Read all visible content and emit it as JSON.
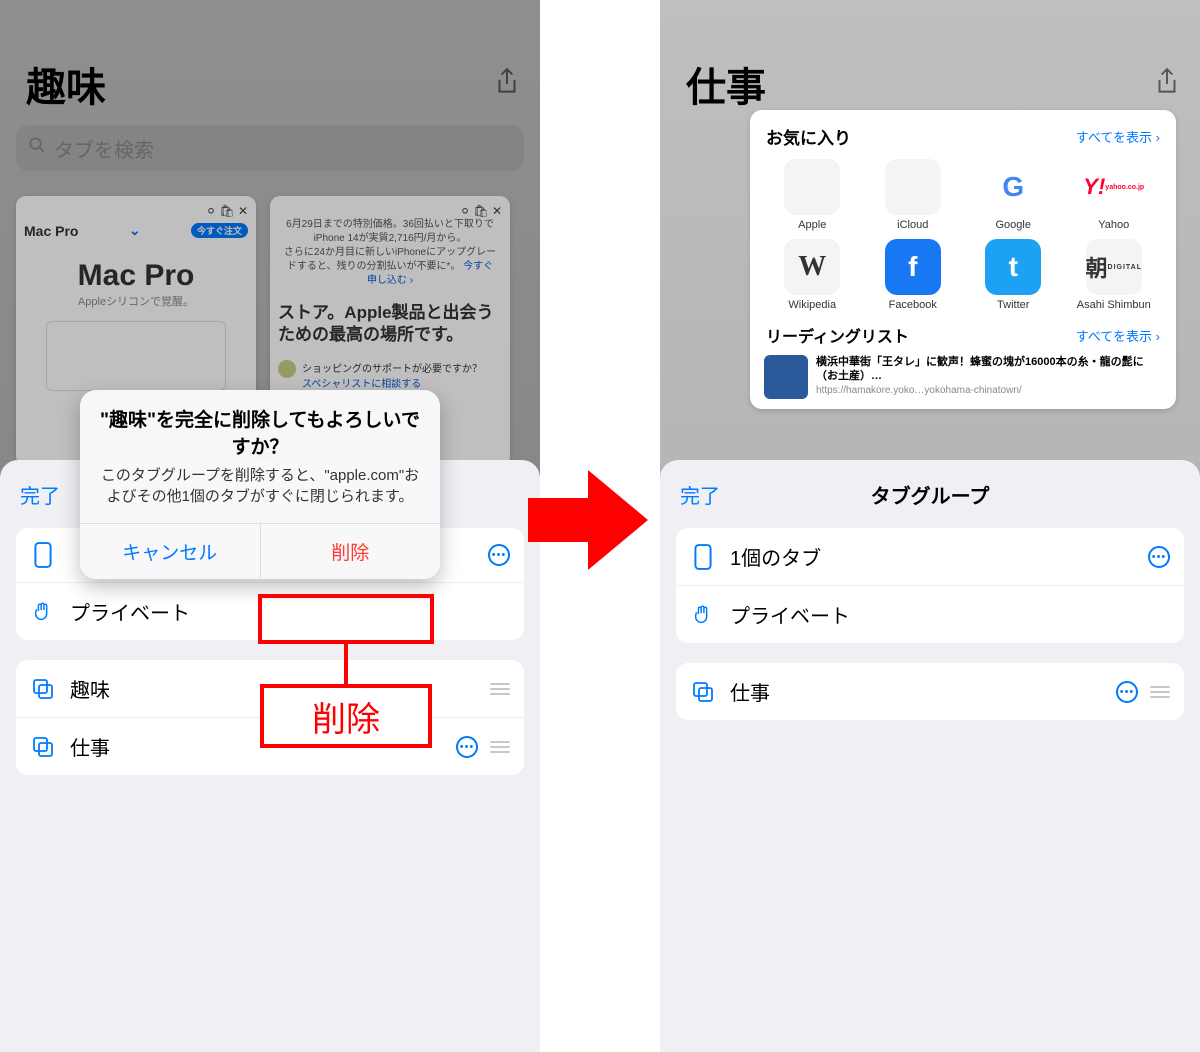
{
  "left": {
    "title": "趣味",
    "search_placeholder": "タブを検索",
    "tab1": {
      "name": "Mac Pro",
      "big": "Mac Pro",
      "sub": "Appleシリコンで覚醒。"
    },
    "tab2": {
      "note1": "6月29日までの特別価格。36回払いと下取りでiPhone 14が実質2,716円/月から。",
      "note2": "さらに24か月目に新しいiPhoneにアップグレードすると、残りの分割払いが不要に*。",
      "applynow": "今すぐ申し込む ›",
      "head": "ストア。Apple製品と出会うための最高の場所です。",
      "support1": "ショッピングのサポートが必要ですか？",
      "support2": "スペシャリストに相談する"
    },
    "sheet": {
      "done": "完了",
      "row_private": "プライベート",
      "row_hobby": "趣味",
      "row_work": "仕事"
    },
    "alert": {
      "title": "\"趣味\"を完全に削除してもよろしいですか？",
      "message": "このタブグループを削除すると、\"apple.com\"およびその他1個のタブがすぐに閉じられます。",
      "cancel": "キャンセル",
      "delete": "削除"
    },
    "annot_label": "削除"
  },
  "right": {
    "title": "仕事",
    "fav": {
      "head": "お気に入り",
      "showall": "すべてを表示",
      "items": [
        {
          "label": "Apple",
          "glyph": ""
        },
        {
          "label": "iCloud",
          "glyph": ""
        },
        {
          "label": "Google",
          "glyph": "G"
        },
        {
          "label": "Yahoo",
          "glyph": "Y!"
        },
        {
          "label": "Wikipedia",
          "glyph": "W"
        },
        {
          "label": "Facebook",
          "glyph": "f"
        },
        {
          "label": "Twitter",
          "glyph": "t"
        },
        {
          "label": "Asahi Shimbun",
          "glyph": "朝"
        }
      ]
    },
    "reading": {
      "head": "リーディングリスト",
      "showall": "すべてを表示",
      "title": "横浜中華街「王タレ」に歓声！蜂蜜の塊が16000本の糸・龍の髭に（お土産）…",
      "url": "https://hamakore.yoko…yokohama-chinatown/"
    },
    "sheet": {
      "done": "完了",
      "title": "タブグループ",
      "row_tabs": "1個のタブ",
      "row_private": "プライベート",
      "row_work": "仕事"
    }
  }
}
